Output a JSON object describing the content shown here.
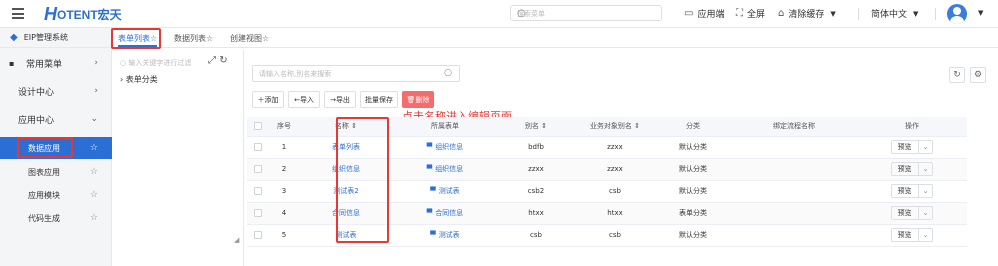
{
  "header": {
    "logo_h": "H",
    "logo_rest": "OTENT宏天",
    "search_placeholder": "搜索菜单",
    "app_label": "应用端",
    "fullscreen_label": "全屏",
    "clear_cache_label": "清除缓存",
    "language_label": "简体中文"
  },
  "sidebar": {
    "system_title": "EIP管理系统",
    "menus": [
      {
        "label": "常用菜单"
      },
      {
        "label": "设计中心"
      },
      {
        "label": "应用中心"
      }
    ],
    "subitems": [
      {
        "label": "数据应用"
      },
      {
        "label": "图表应用"
      },
      {
        "label": "应用模块"
      },
      {
        "label": "代码生成"
      }
    ]
  },
  "tabs": [
    {
      "label": "表单列表"
    },
    {
      "label": "数据列表"
    },
    {
      "label": "创建视图"
    }
  ],
  "tree": {
    "search_placeholder": "输入关键字进行过滤",
    "root_label": "表单分类"
  },
  "toolbar": {
    "search_placeholder": "请输入名称,別名来搜索",
    "add": "添加",
    "import": "导入",
    "export": "导出",
    "batch_save": "批量保存",
    "delete": "删除"
  },
  "annotation": "点击名称进入编辑页面",
  "table": {
    "headers": [
      "序号",
      "名称",
      "所属表单",
      "别名",
      "业务对象别名",
      "分类",
      "绑定流程名称",
      "操作"
    ],
    "rows": [
      {
        "no": "1",
        "name": "表单列表",
        "form": "组织信息",
        "alias": "bdfb",
        "bo_alias": "zzxx",
        "category": "默认分类",
        "flow": "",
        "action": "预览"
      },
      {
        "no": "2",
        "name": "组织信息",
        "form": "组织信息",
        "alias": "zzxx",
        "bo_alias": "zzxx",
        "category": "默认分类",
        "flow": "",
        "action": "预览"
      },
      {
        "no": "3",
        "name": "测试表2",
        "form": "测试表",
        "alias": "csb2",
        "bo_alias": "csb",
        "category": "默认分类",
        "flow": "",
        "action": "预览"
      },
      {
        "no": "4",
        "name": "合同信息",
        "form": "合同信息",
        "alias": "htxx",
        "bo_alias": "htxx",
        "category": "表单分类",
        "flow": "",
        "action": "预览"
      },
      {
        "no": "5",
        "name": "测试表",
        "form": "测试表",
        "alias": "csb",
        "bo_alias": "csb",
        "category": "默认分类",
        "flow": "",
        "action": "预览"
      }
    ]
  }
}
